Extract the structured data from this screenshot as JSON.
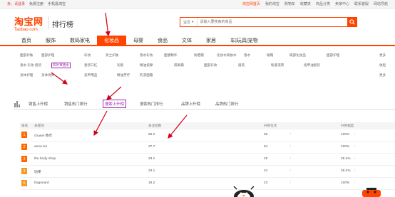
{
  "topbar": {
    "hello": "亲，请登录",
    "free_reg": "免费注册",
    "mobile": "手机逛淘宝",
    "links": [
      "淘宝网首页",
      "我的淘宝",
      "购物车",
      "收藏夹",
      "商品分类",
      "卖家中心",
      "联系客服",
      "网站导航"
    ]
  },
  "header": {
    "logo_cn": "淘宝网",
    "logo_en": "Taobao.com",
    "page_title": "排行榜",
    "search_type": "宝贝",
    "search_placeholder": "请输入要搜索的商品"
  },
  "nav": [
    "首页",
    "服饰",
    "数码家电",
    "化妆品",
    "母婴",
    "食品",
    "文体",
    "家居",
    "车|玩具|宠物"
  ],
  "nav_active": "化妆品",
  "subcats": {
    "row1": [
      "面部护肤",
      "面部护理",
      "彩妆",
      "男士护肤",
      "香水彩妆",
      "面膜精华",
      "防晒霜",
      "化妆水爽肤水",
      "香水",
      "眼霜",
      "眼部化妆品",
      "面部护理"
    ],
    "row1_more": "更多",
    "row2": [
      "香水 彩妆 套装",
      "四叶草香水",
      "套装口红",
      "润唇",
      "精油按摩",
      "隔离霜",
      "面部彩妆",
      "眉笔",
      "粉底液膏",
      "指甲油套装"
    ],
    "row2_more": "收起",
    "row3": [
      "身体护理",
      "身体保养",
      "美甲用品",
      "精油芳疗",
      "乳液面霜"
    ],
    "row3_more": "更多"
  },
  "tabs": [
    "销售上升榜",
    "销售热门排行",
    "搜索上升榜",
    "搜索热门排行",
    "品牌上升榜",
    "品牌热门排行"
  ],
  "tab_active": "搜索上升榜",
  "table": {
    "headers": [
      "排名",
      "关键词",
      "关注指数",
      "升降位次",
      "升降幅度"
    ],
    "rows": [
      {
        "rank": "1",
        "keyword": "chanel 香奈",
        "index": "56.2",
        "change": "69",
        "pct": "100%"
      },
      {
        "rank": "2",
        "keyword": "anna sui",
        "index": "37.7",
        "change": "54",
        "pct": "100%"
      },
      {
        "rank": "3",
        "keyword": "the body shop",
        "index": "23.1",
        "change": "25",
        "pct": "28.4%"
      },
      {
        "rank": "4",
        "keyword": "珀莱",
        "index": "23.1",
        "change": "24",
        "pct": "28.2%"
      },
      {
        "rank": "5",
        "keyword": "fragonard",
        "index": "18.2",
        "change": "23",
        "pct": "100%"
      }
    ]
  },
  "colors": {
    "brand": "#ff4400",
    "selected": "#9c27b0",
    "arrow": "#f59b23",
    "annotation": "#d0021b"
  }
}
